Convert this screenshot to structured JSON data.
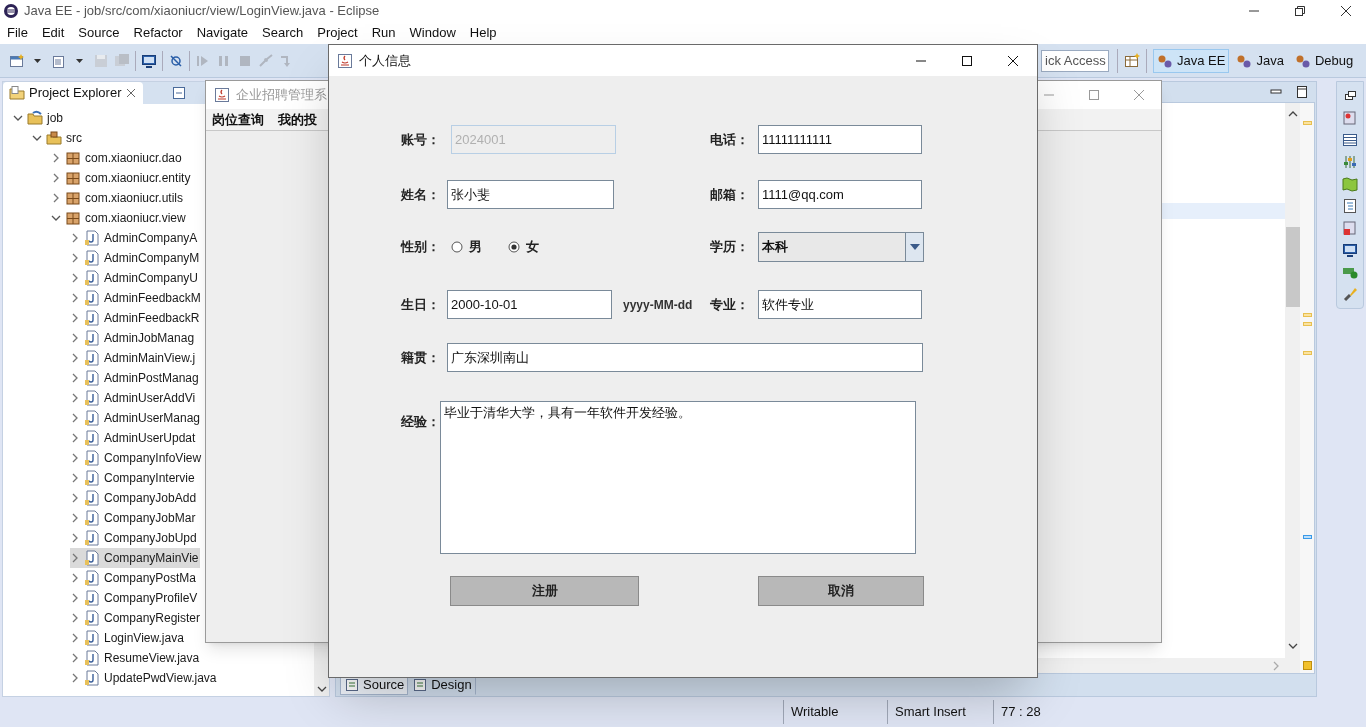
{
  "eclipse": {
    "title": "Java EE - job/src/com/xiaoniucr/view/LoginView.java - Eclipse",
    "menu": [
      "File",
      "Edit",
      "Source",
      "Refactor",
      "Navigate",
      "Search",
      "Project",
      "Run",
      "Window",
      "Help"
    ],
    "quick_access": {
      "placeholder": "ick Access"
    },
    "perspectives": [
      {
        "label": "Java EE",
        "selected": true
      },
      {
        "label": "Java",
        "selected": false
      },
      {
        "label": "Debug",
        "selected": false
      }
    ],
    "project_explorer": {
      "title": "Project Explorer",
      "tree": [
        {
          "label": "job",
          "kind": "project",
          "expanded": true,
          "selected": false,
          "children": [
            {
              "label": "src",
              "kind": "folder",
              "expanded": true,
              "selected": false,
              "children": [
                {
                  "label": "com.xiaoniucr.dao",
                  "kind": "package",
                  "expanded": false,
                  "selected": false
                },
                {
                  "label": "com.xiaoniucr.entity",
                  "kind": "package",
                  "expanded": false,
                  "selected": false
                },
                {
                  "label": "com.xiaoniucr.utils",
                  "kind": "package",
                  "expanded": false,
                  "selected": false
                },
                {
                  "label": "com.xiaoniucr.view",
                  "kind": "package",
                  "expanded": true,
                  "selected": false,
                  "children": [
                    {
                      "label": "AdminCompanyA",
                      "kind": "file",
                      "expanded": false,
                      "selected": false
                    },
                    {
                      "label": "AdminCompanyM",
                      "kind": "file",
                      "expanded": false,
                      "selected": false
                    },
                    {
                      "label": "AdminCompanyU",
                      "kind": "file",
                      "expanded": false,
                      "selected": false
                    },
                    {
                      "label": "AdminFeedbackM",
                      "kind": "file",
                      "expanded": false,
                      "selected": false
                    },
                    {
                      "label": "AdminFeedbackR",
                      "kind": "file",
                      "expanded": false,
                      "selected": false
                    },
                    {
                      "label": "AdminJobManag",
                      "kind": "file",
                      "expanded": false,
                      "selected": false
                    },
                    {
                      "label": "AdminMainView.j",
                      "kind": "file",
                      "expanded": false,
                      "selected": false
                    },
                    {
                      "label": "AdminPostManag",
                      "kind": "file",
                      "expanded": false,
                      "selected": false
                    },
                    {
                      "label": "AdminUserAddVi",
                      "kind": "file",
                      "expanded": false,
                      "selected": false
                    },
                    {
                      "label": "AdminUserManag",
                      "kind": "file",
                      "expanded": false,
                      "selected": false
                    },
                    {
                      "label": "AdminUserUpdat",
                      "kind": "file",
                      "expanded": false,
                      "selected": false
                    },
                    {
                      "label": "CompanyInfoView",
                      "kind": "file",
                      "expanded": false,
                      "selected": false
                    },
                    {
                      "label": "CompanyIntervie",
                      "kind": "file",
                      "expanded": false,
                      "selected": false
                    },
                    {
                      "label": "CompanyJobAdd",
                      "kind": "file",
                      "expanded": false,
                      "selected": false
                    },
                    {
                      "label": "CompanyJobMar",
                      "kind": "file",
                      "expanded": false,
                      "selected": false
                    },
                    {
                      "label": "CompanyJobUpd",
                      "kind": "file",
                      "expanded": false,
                      "selected": false
                    },
                    {
                      "label": "CompanyMainVie",
                      "kind": "file",
                      "expanded": false,
                      "selected": true
                    },
                    {
                      "label": "CompanyPostMa",
                      "kind": "file",
                      "expanded": false,
                      "selected": false
                    },
                    {
                      "label": "CompanyProfileV",
                      "kind": "file",
                      "expanded": false,
                      "selected": false
                    },
                    {
                      "label": "CompanyRegister",
                      "kind": "file",
                      "expanded": false,
                      "selected": false
                    },
                    {
                      "label": "LoginView.java",
                      "kind": "file",
                      "expanded": false,
                      "selected": false
                    },
                    {
                      "label": "ResumeView.java",
                      "kind": "file",
                      "expanded": false,
                      "selected": false
                    },
                    {
                      "label": "UpdatePwdView.java",
                      "kind": "file",
                      "expanded": false,
                      "selected": false
                    }
                  ]
                }
              ]
            }
          ]
        }
      ]
    },
    "editor_tabs": [
      {
        "label": "Source",
        "selected": true
      },
      {
        "label": "Design",
        "selected": false
      }
    ],
    "status_bar": [
      "Writable",
      "Smart Insert",
      "77 : 28"
    ]
  },
  "main_window": {
    "title": "企业招聘管理系",
    "menu": [
      "岗位查询",
      "我的投"
    ]
  },
  "dialog": {
    "title": "个人信息",
    "account": {
      "label": "账号：",
      "value": "2024001",
      "disabled": true
    },
    "phone": {
      "label": "电话：",
      "value": "11111111111"
    },
    "name": {
      "label": "姓名：",
      "value": "张小斐"
    },
    "email": {
      "label": "邮箱：",
      "value": "1111@qq.com"
    },
    "gender": {
      "label": "性别：",
      "options": [
        {
          "label": "男",
          "selected": false
        },
        {
          "label": "女",
          "selected": true
        }
      ]
    },
    "education": {
      "label": "学历：",
      "value": "本科"
    },
    "birthday": {
      "label": "生日：",
      "value": "2000-10-01",
      "hint": "yyyy-MM-dd"
    },
    "major": {
      "label": "专业：",
      "value": "软件专业"
    },
    "hometown": {
      "label": "籍贯：",
      "value": "广东深圳南山"
    },
    "experience": {
      "label": "经验：",
      "value": "毕业于清华大学，具有一年软件开发经验。"
    },
    "buttons": [
      "注册",
      "取消"
    ]
  }
}
